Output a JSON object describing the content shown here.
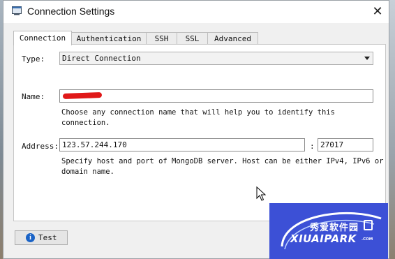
{
  "window": {
    "title": "Connection Settings",
    "close_glyph": "✕"
  },
  "tabs": [
    "Connection",
    "Authentication",
    "SSH",
    "SSL",
    "Advanced"
  ],
  "active_tab": "Connection",
  "form": {
    "type_label": "Type:",
    "type_value": "Direct Connection",
    "name_label": "Name:",
    "name_value": "",
    "name_hint": "Choose any connection name that will help you to identify this connection.",
    "address_label": "Address:",
    "host_value": "123.57.244.170",
    "separator": ":",
    "port_value": "27017",
    "address_hint_line1": "Specify host and port of MongoDB server. Host can be either IPv4, IPv6 or",
    "address_hint_line2": "domain name."
  },
  "footer": {
    "test_label": "Test",
    "info_glyph": "i"
  },
  "watermark": {
    "chinese": "秀爱软件园",
    "english": "XIUAIPARK",
    "suffix": ".COM"
  },
  "icons": [
    "app-window-icon",
    "close-icon",
    "dropdown-arrow-icon",
    "info-icon",
    "mouse-cursor-icon",
    "download-icon"
  ]
}
